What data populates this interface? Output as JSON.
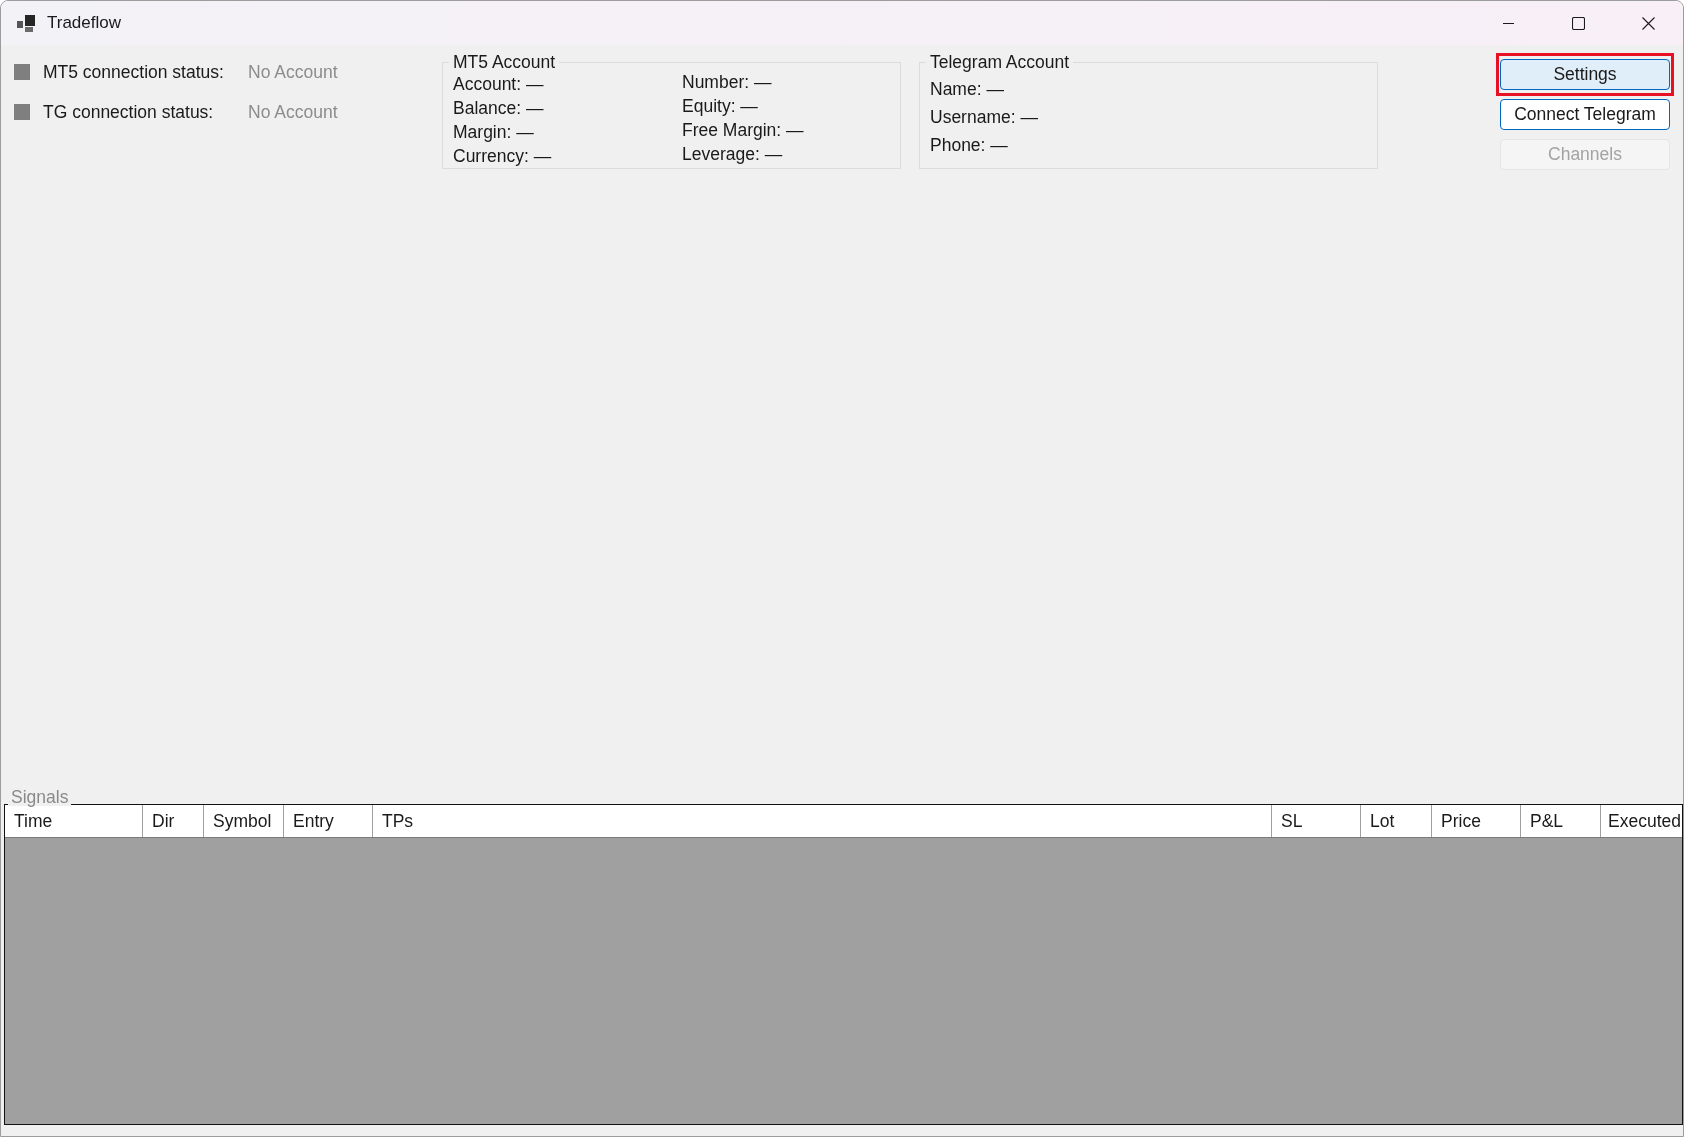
{
  "window": {
    "title": "Tradeflow"
  },
  "connection_status": [
    {
      "label": "MT5 connection status:",
      "value": "No Account",
      "color": "#7f7f7f"
    },
    {
      "label": "TG connection status:",
      "value": "No Account",
      "color": "#7f7f7f"
    }
  ],
  "mt5_account": {
    "title": "MT5 Account",
    "columns": [
      {
        "fields": [
          "Account: —",
          "Balance: —",
          "Margin: —",
          "Currency: —"
        ]
      },
      {
        "fields": [
          "Number: —",
          "Equity: —",
          "Free Margin: —",
          "Leverage: —"
        ]
      }
    ]
  },
  "telegram_account": {
    "title": "Telegram Account",
    "fields": [
      "Name: —",
      "Username: —",
      "Phone: —"
    ]
  },
  "buttons": [
    {
      "label": "Settings",
      "hovered": true,
      "focused": false,
      "disabled": false,
      "highlighted": true
    },
    {
      "label": "Connect Telegram",
      "hovered": false,
      "focused": true,
      "disabled": false,
      "highlighted": false
    },
    {
      "label": "Channels",
      "hovered": false,
      "focused": false,
      "disabled": true,
      "highlighted": false
    }
  ],
  "signals": {
    "title": "Signals",
    "columns": [
      "Time",
      "Dir",
      "Symbol",
      "Entry",
      "TPs",
      "SL",
      "Lot",
      "Price",
      "P&L",
      "Executed"
    ]
  }
}
